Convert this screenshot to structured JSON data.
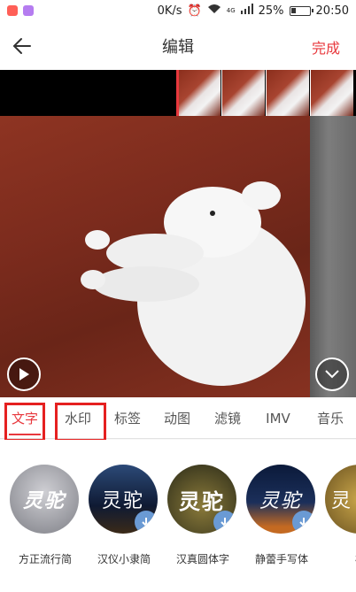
{
  "status_bar": {
    "network_speed": "0K/s",
    "signal_label": "4G",
    "battery": "25%",
    "time": "20:50"
  },
  "header": {
    "title": "编辑",
    "done_label": "完成"
  },
  "tabs": [
    {
      "label": "文字",
      "active": true
    },
    {
      "label": "水印",
      "active": false
    },
    {
      "label": "标签",
      "active": false
    },
    {
      "label": "动图",
      "active": false
    },
    {
      "label": "滤镜",
      "active": false
    },
    {
      "label": "IMV",
      "active": false
    },
    {
      "label": "音乐",
      "active": false
    }
  ],
  "fonts": [
    {
      "preview": "灵驼",
      "name": "方正流行简",
      "download": false
    },
    {
      "preview": "灵驼",
      "name": "汉仪小隶简",
      "download": true
    },
    {
      "preview": "灵驼",
      "name": "汉真圆体字",
      "download": true
    },
    {
      "preview": "灵驼",
      "name": "静蕾手写体",
      "download": true
    },
    {
      "preview": "灵",
      "name": "楷",
      "download": false
    }
  ],
  "colors": {
    "accent": "#e8383d",
    "highlight_box": "#e52020",
    "download_badge": "#6a9ad4"
  }
}
